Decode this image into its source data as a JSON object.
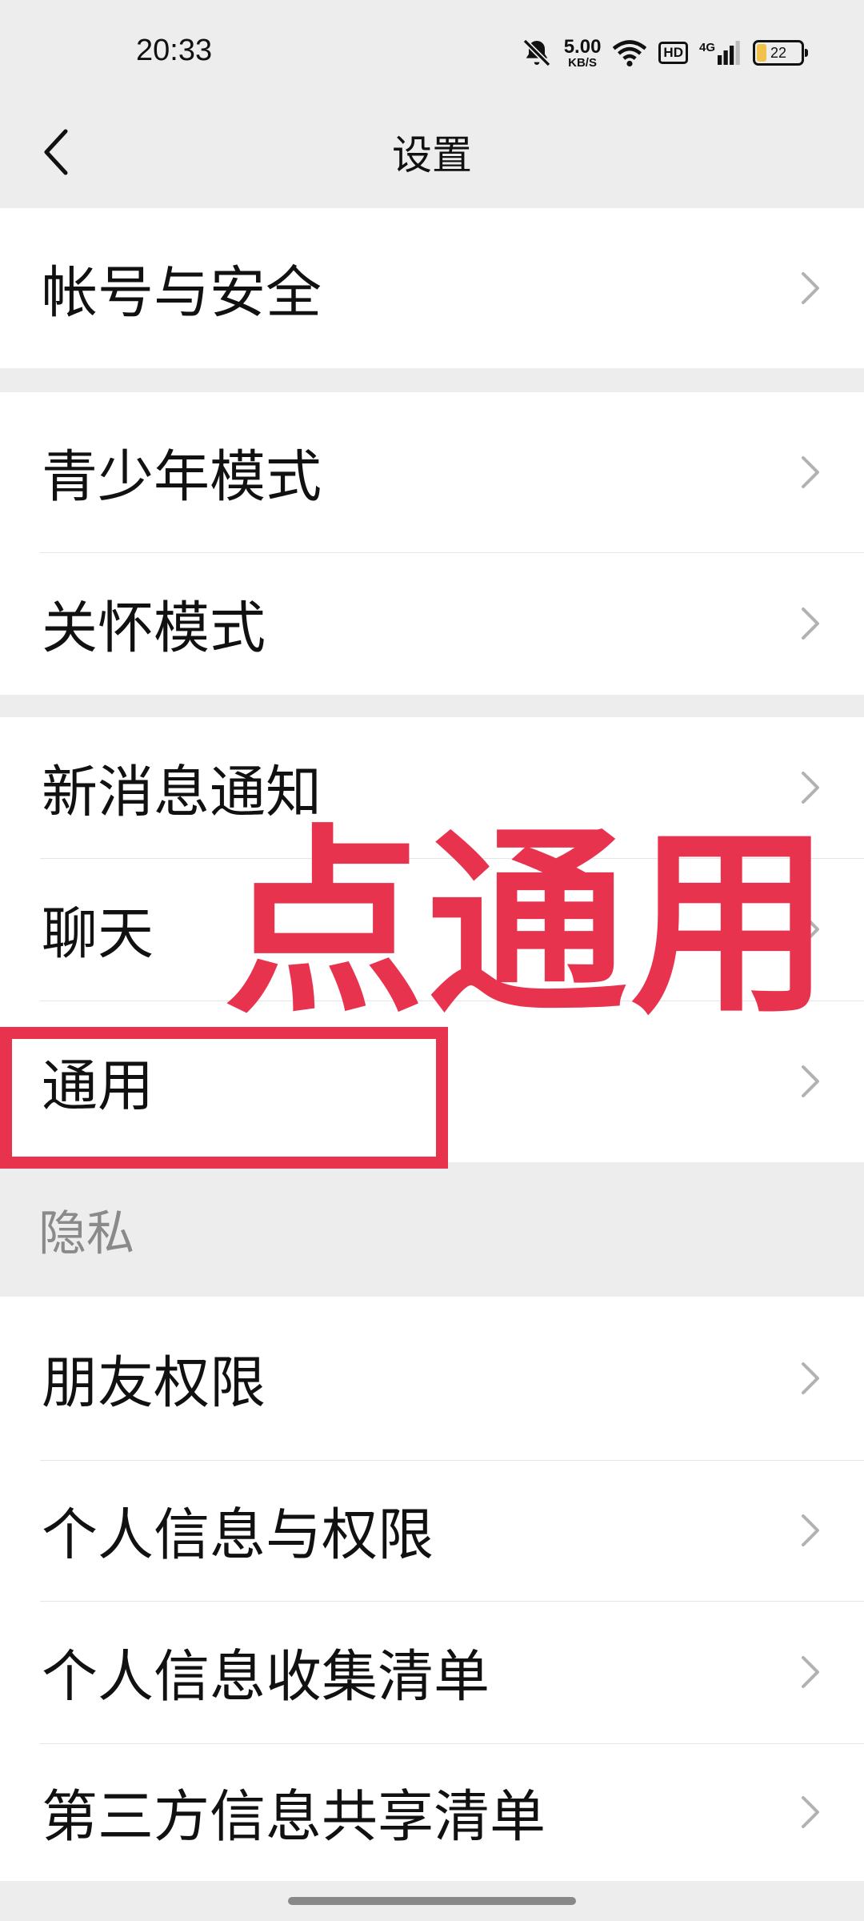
{
  "status_bar": {
    "time": "20:33",
    "speed_value": "5.00",
    "speed_unit": "KB/S",
    "hd_label": "HD",
    "network_label": "4G",
    "battery_level": "22"
  },
  "nav": {
    "title": "设置"
  },
  "groups": {
    "account": [
      "帐号与安全"
    ],
    "modes": [
      "青少年模式",
      "关怀模式"
    ],
    "general": [
      "新消息通知",
      "聊天",
      "通用"
    ],
    "privacy_header": "隐私",
    "privacy": [
      "朋友权限",
      "个人信息与权限",
      "个人信息收集清单",
      "第三方信息共享清单"
    ]
  },
  "annotation": {
    "text": "点通用",
    "color": "#e8334f"
  },
  "colors": {
    "background": "#ededed",
    "card": "#ffffff",
    "chevron": "#b2b2b2"
  }
}
